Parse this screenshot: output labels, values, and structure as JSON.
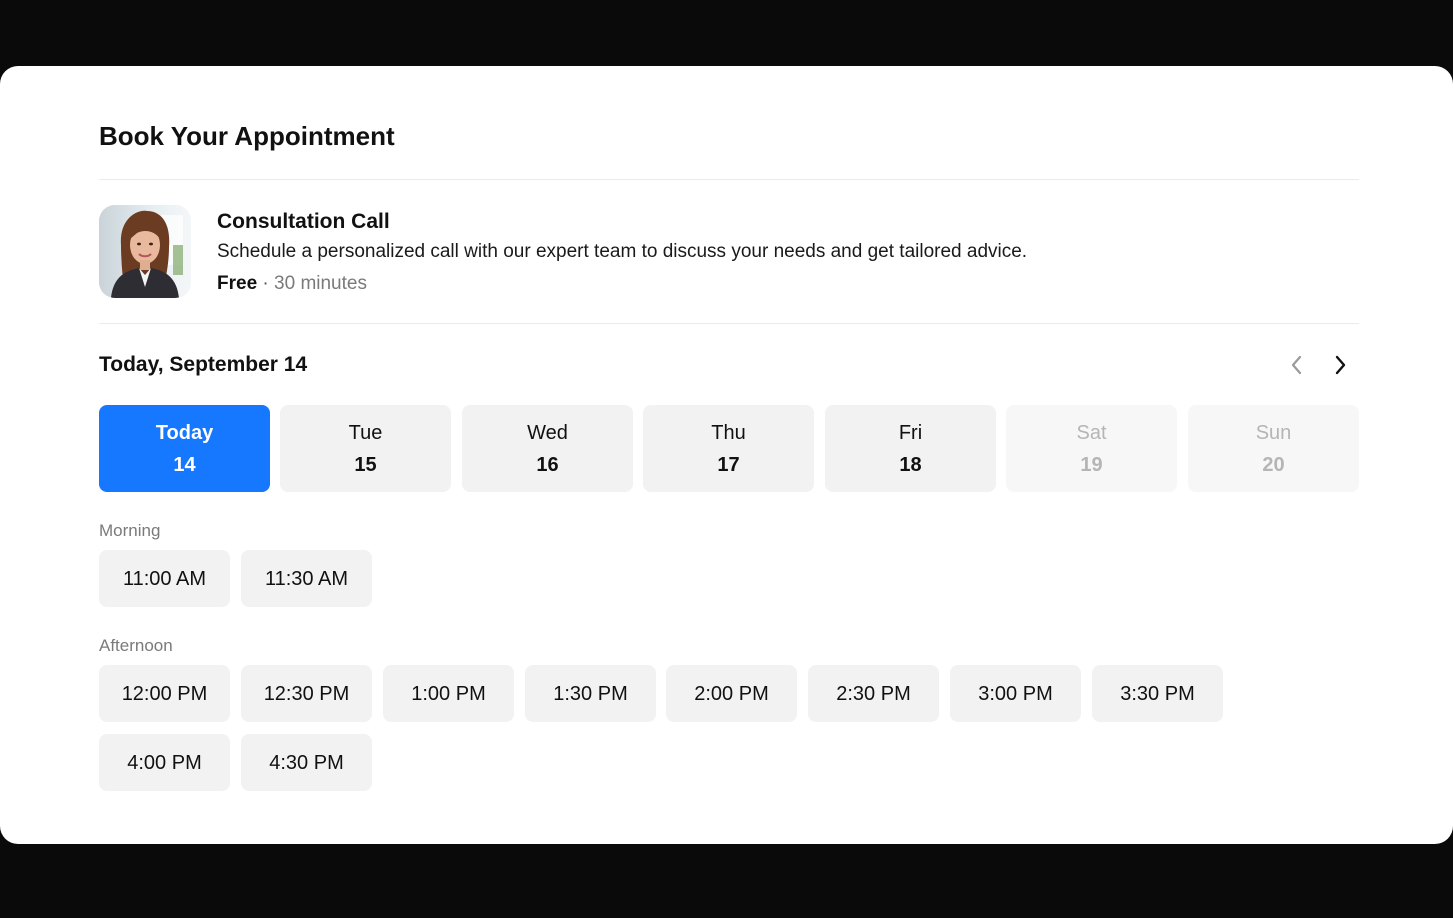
{
  "page": {
    "title": "Book Your Appointment"
  },
  "service": {
    "name": "Consultation Call",
    "description": "Schedule a personalized call with our expert team to discuss your needs and get tailored advice.",
    "price": "Free",
    "separator": "·",
    "duration": "30 minutes",
    "avatar_icon": "person-portrait-photo"
  },
  "calendar": {
    "heading": "Today, September 14",
    "prev_icon": "chevron-left-icon",
    "next_icon": "chevron-right-icon",
    "days": [
      {
        "name": "Today",
        "num": "14",
        "state": "selected"
      },
      {
        "name": "Tue",
        "num": "15",
        "state": "available"
      },
      {
        "name": "Wed",
        "num": "16",
        "state": "available"
      },
      {
        "name": "Thu",
        "num": "17",
        "state": "available"
      },
      {
        "name": "Fri",
        "num": "18",
        "state": "available"
      },
      {
        "name": "Sat",
        "num": "19",
        "state": "disabled"
      },
      {
        "name": "Sun",
        "num": "20",
        "state": "disabled"
      }
    ]
  },
  "slots": {
    "morning_label": "Morning",
    "morning": [
      "11:00 AM",
      "11:30 AM"
    ],
    "afternoon_label": "Afternoon",
    "afternoon": [
      "12:00 PM",
      "12:30 PM",
      "1:00 PM",
      "1:30 PM",
      "2:00 PM",
      "2:30 PM",
      "3:00 PM",
      "3:30 PM",
      "4:00 PM",
      "4:30 PM"
    ]
  },
  "colors": {
    "accent": "#1677ff",
    "backdrop": "#0a0a0a",
    "card": "#ffffff",
    "chip": "#f2f2f2",
    "muted_text": "#7a7a7a",
    "disabled_text": "#b5b5b5"
  }
}
